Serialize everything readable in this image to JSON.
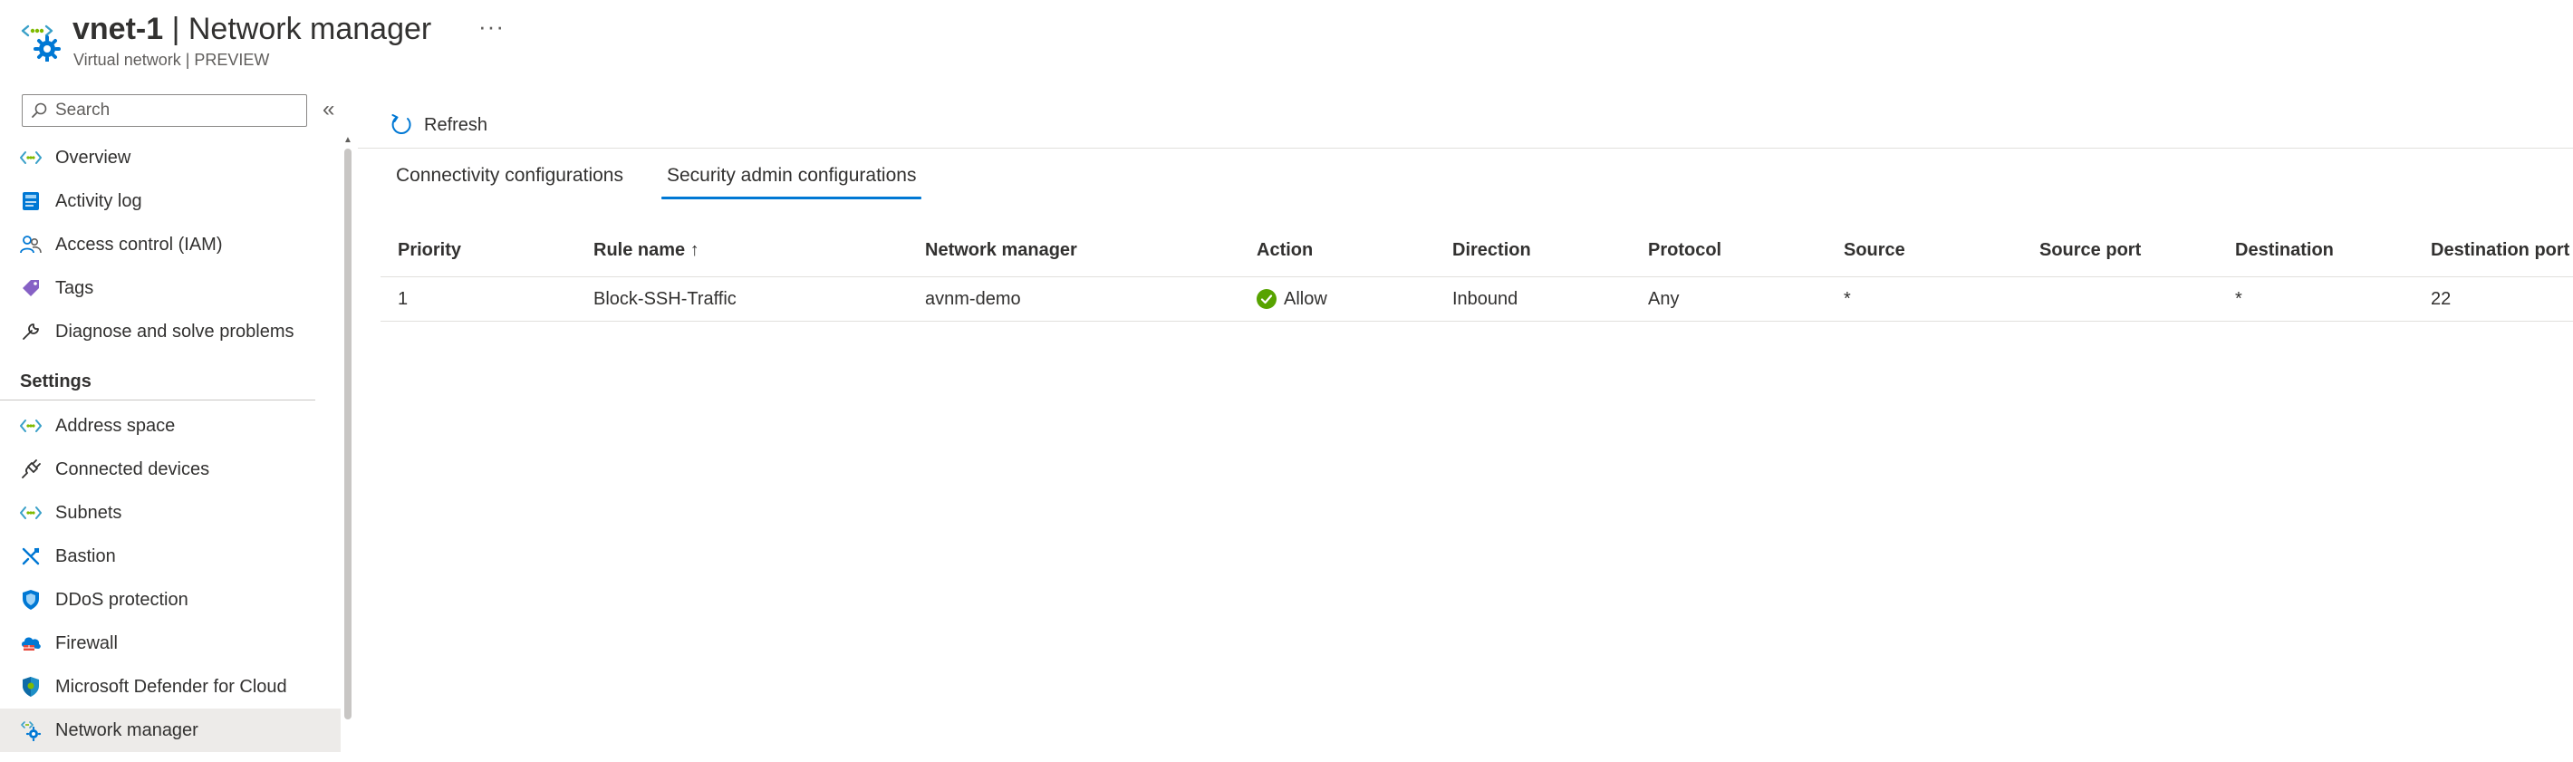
{
  "header": {
    "resource_name": "vnet-1",
    "separator": " | ",
    "page_name": "Network manager",
    "more": "···",
    "subtitle": "Virtual network | PREVIEW"
  },
  "sidebar": {
    "search_placeholder": "Search",
    "collapse_glyph": "«",
    "items_top": [
      {
        "label": "Overview",
        "icon": "network-brackets-icon"
      },
      {
        "label": "Activity log",
        "icon": "activity-log-icon"
      },
      {
        "label": "Access control (IAM)",
        "icon": "people-icon"
      },
      {
        "label": "Tags",
        "icon": "tag-icon"
      },
      {
        "label": "Diagnose and solve problems",
        "icon": "wrench-icon"
      }
    ],
    "section_settings": "Settings",
    "items_settings": [
      {
        "label": "Address space",
        "icon": "network-brackets-icon"
      },
      {
        "label": "Connected devices",
        "icon": "plug-icon"
      },
      {
        "label": "Subnets",
        "icon": "network-brackets-icon"
      },
      {
        "label": "Bastion",
        "icon": "bastion-icon"
      },
      {
        "label": "DDoS protection",
        "icon": "shield-icon"
      },
      {
        "label": "Firewall",
        "icon": "firewall-icon"
      },
      {
        "label": "Microsoft Defender for Cloud",
        "icon": "defender-shield-icon"
      },
      {
        "label": "Network manager",
        "icon": "network-manager-icon",
        "selected": true
      }
    ]
  },
  "toolbar": {
    "refresh_label": "Refresh"
  },
  "tabs": [
    {
      "label": "Connectivity configurations",
      "active": false
    },
    {
      "label": "Security admin configurations",
      "active": true
    }
  ],
  "table": {
    "columns": [
      "Priority",
      "Rule name ↑",
      "Network manager",
      "Action",
      "Direction",
      "Protocol",
      "Source",
      "Source port",
      "Destination",
      "Destination port"
    ],
    "rows": [
      {
        "priority": "1",
        "rule_name": "Block-SSH-Traffic",
        "network_manager": "avnm-demo",
        "action": "Allow",
        "direction": "Inbound",
        "protocol": "Any",
        "source": "*",
        "source_port": "",
        "destination": "*",
        "destination_port": "22"
      }
    ]
  },
  "colors": {
    "accent": "#0078d4",
    "allow_green": "#57a300",
    "selected_bg": "#edebe9"
  }
}
